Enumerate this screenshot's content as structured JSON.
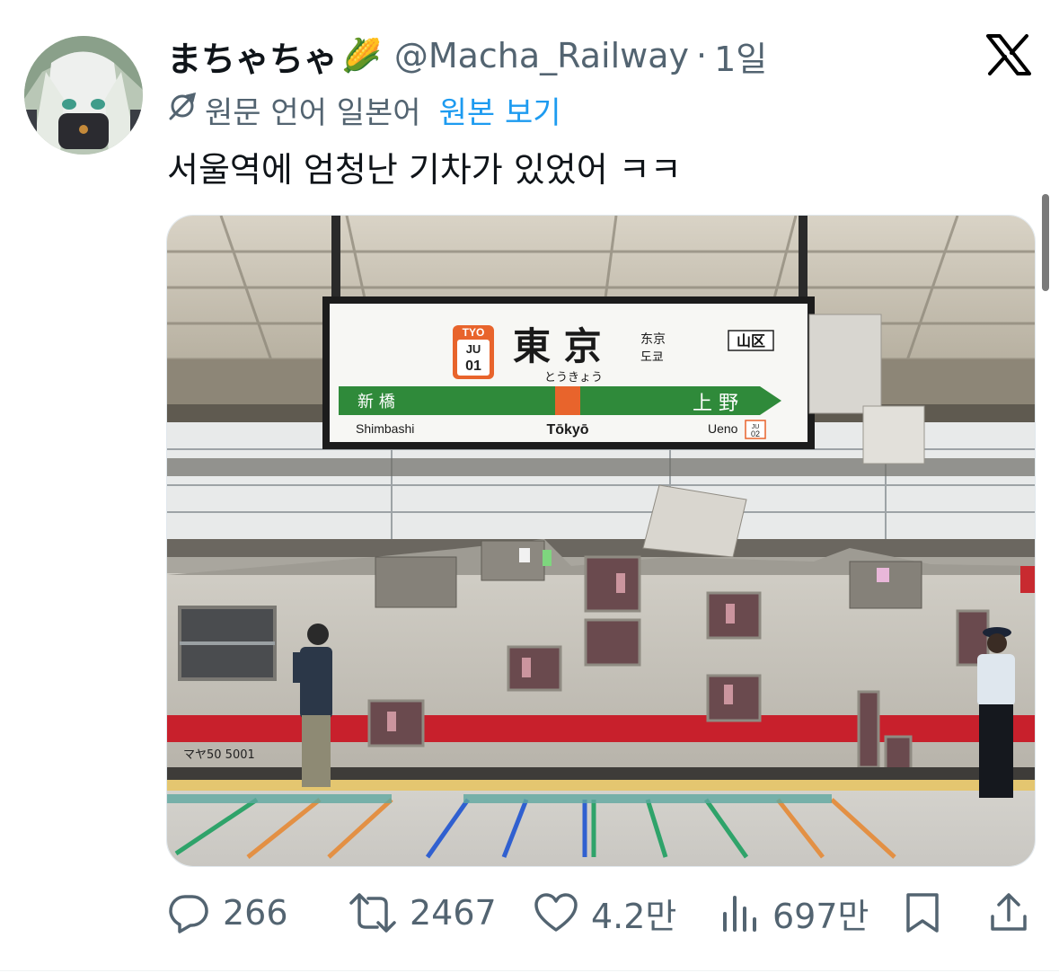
{
  "author": {
    "display_name": "まちゃちゃ",
    "emoji": "🌽",
    "handle": "@Macha_Railway",
    "separator": "·",
    "time": "1일"
  },
  "translation": {
    "note": "원문 언어 일본어",
    "show_original": "원본 보기"
  },
  "tweet": {
    "text": "서울역에 엄청난 기차가 있었어 ㅋㅋ"
  },
  "photo": {
    "sign": {
      "code": "TYO",
      "line_code": "JU",
      "line_number": "01",
      "name_kanji": "東 京",
      "name_hiragana": "とうきょう",
      "name_chinese": "东京",
      "name_korean": "도쿄",
      "zone_badge": "山区",
      "prev_kanji": "新 橋",
      "next_kanji": "上 野",
      "prev_romaji": "Shimbashi",
      "name_romaji": "Tōkyō",
      "next_romaji": "Ueno",
      "next_code": "JU",
      "next_number": "02",
      "line_color": "#2f8a3a",
      "station_color": "#e8642c"
    },
    "train": {
      "car_number": "マヤ50 5001",
      "stripe_color": "#c8202c"
    }
  },
  "actions": {
    "replies": "266",
    "reposts": "2467",
    "likes": "4.2만",
    "views": "697만"
  },
  "icons": {
    "x_logo": "x-logo-icon",
    "translate": "translate-icon",
    "reply": "reply-icon",
    "repost": "repost-icon",
    "like": "heart-icon",
    "views": "views-icon",
    "bookmark": "bookmark-icon",
    "share": "share-icon"
  }
}
